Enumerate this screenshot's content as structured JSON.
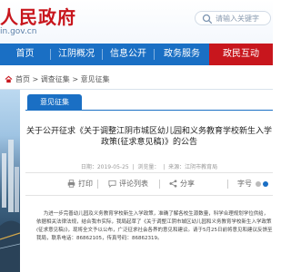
{
  "header": {
    "site_name": "人民政府",
    "site_domain": "in.gov.cn",
    "search_placeholder": "请输入关键字"
  },
  "nav": {
    "items": [
      {
        "label": "首页"
      },
      {
        "label": "江阴概况"
      },
      {
        "label": "信息公开"
      },
      {
        "label": "政务服务"
      },
      {
        "label": "政民互动"
      }
    ],
    "active_index": 4,
    "bar_color": "#1a6fc4",
    "active_color": "#c8161d"
  },
  "breadcrumb": {
    "items": [
      "首页",
      "调查征集",
      "意见征集"
    ],
    "separator": " > "
  },
  "tab": {
    "label": "意见征集"
  },
  "article": {
    "title": "关于公开征求《关于调整江阴市城区幼儿园和义务教育学校新生入学政策(征求意见稿)》的公告",
    "date_label": "日期：2019-05-25",
    "views_label": "浏览量：",
    "source_label": "来源：江阴市教育局",
    "body_text": "为进一步完善幼儿园及义务教育学校新生入学政策，准确了解各校生源数量，科学合理规划学位供给，依据相关法律法规，结合我市实际，我局起草了《关于调整江阴市城区幼儿园和义务教育学校新生入学政策(征求意见稿)》，现将全文予以公布，广泛征求社会各界的意见和建议。请于5月25日前将意见和建议反馈至我局，联系电话：86862105，传真号码：86862319。"
  },
  "actions": {
    "print_label": "打印",
    "share_label": "分享",
    "comments_label": "评论列表",
    "font_size_label": "字号"
  }
}
